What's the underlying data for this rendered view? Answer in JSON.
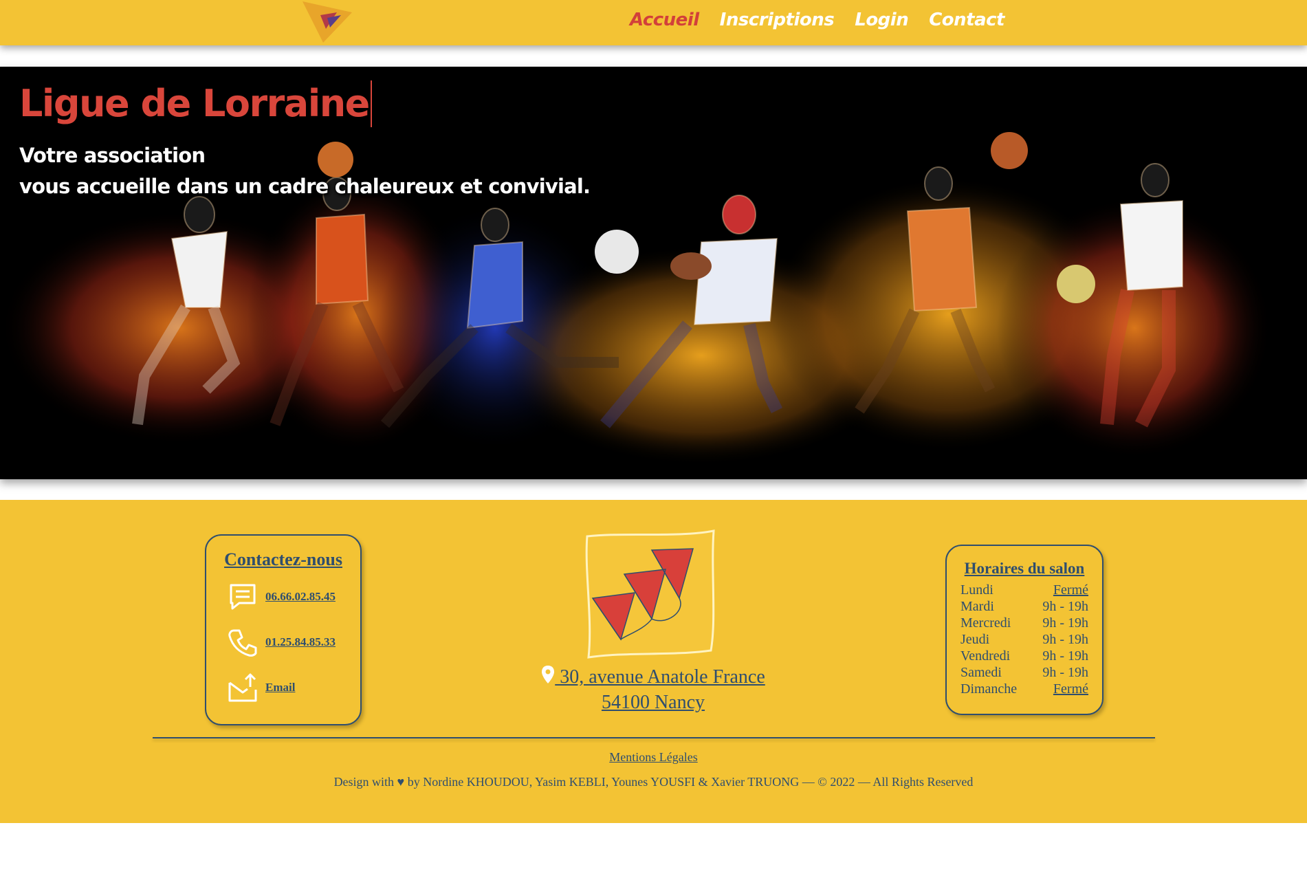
{
  "nav": {
    "items": [
      {
        "label": "Accueil",
        "active": true
      },
      {
        "label": "Inscriptions",
        "active": false
      },
      {
        "label": "Login",
        "active": false
      },
      {
        "label": "Contact",
        "active": false
      }
    ]
  },
  "hero": {
    "title": "Ligue de Lorraine",
    "subtitle_line1": "Votre association",
    "subtitle_line2": "vous accueille dans un cadre chaleureux et convivial."
  },
  "contact": {
    "title": "Contactez-nous",
    "phone_mobile": "06.66.02.85.45",
    "phone_landline": "01.25.84.85.33",
    "email_label": "Email"
  },
  "address": {
    "line1": " 30, avenue Anatole France",
    "line2": "54100 Nancy"
  },
  "hours": {
    "title": "Horaires du salon",
    "rows": [
      {
        "day": "Lundi",
        "time": "Fermé",
        "closed": true
      },
      {
        "day": "Mardi",
        "time": "9h - 19h",
        "closed": false
      },
      {
        "day": "Mercredi",
        "time": "9h - 19h",
        "closed": false
      },
      {
        "day": "Jeudi",
        "time": "9h - 19h",
        "closed": false
      },
      {
        "day": "Vendredi",
        "time": "9h - 19h",
        "closed": false
      },
      {
        "day": "Samedi",
        "time": "9h - 19h",
        "closed": false
      },
      {
        "day": "Dimanche",
        "time": "Fermé",
        "closed": true
      }
    ]
  },
  "footer": {
    "legal_label": "Mentions Légales",
    "credits": "Design with ♥ by Nordine KHOUDOU, Yasim KEBLI, Younes YOUSFI & Xavier TRUONG — © 2022 — All Rights Reserved"
  },
  "colors": {
    "brand_yellow": "#f3c334",
    "accent_red": "#d2403a",
    "navy": "#2f4e6e"
  }
}
